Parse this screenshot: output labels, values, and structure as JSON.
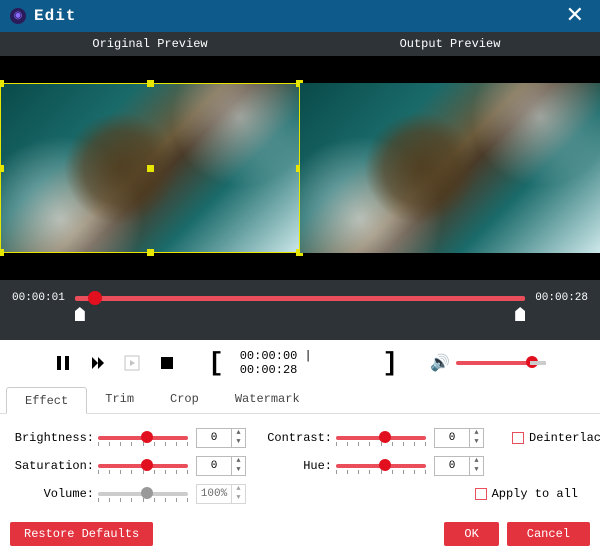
{
  "title": "Edit",
  "close_glyph": "✕",
  "preview": {
    "original_label": "Original Preview",
    "output_label": "Output Preview"
  },
  "timeline": {
    "current": "00:00:01",
    "total": "00:00:28",
    "playhead_pct": 3,
    "mark_in_pct": 0,
    "mark_out_pct": 100
  },
  "range": {
    "in": "00:00:00",
    "out": "00:00:28",
    "sep": " | "
  },
  "volume": {
    "pct": 82
  },
  "tabs": {
    "effect": "Effect",
    "trim": "Trim",
    "crop": "Crop",
    "watermark": "Watermark",
    "active": "effect"
  },
  "effects": {
    "brightness": {
      "label": "Brightness:",
      "value": "0",
      "pos_pct": 50
    },
    "contrast": {
      "label": "Contrast:",
      "value": "0",
      "pos_pct": 50
    },
    "saturation": {
      "label": "Saturation:",
      "value": "0",
      "pos_pct": 50
    },
    "hue": {
      "label": "Hue:",
      "value": "0",
      "pos_pct": 50
    },
    "volume": {
      "label": "Volume:",
      "value": "100%",
      "pos_pct": 50
    }
  },
  "checkboxes": {
    "deinterlacing": "Deinterlacing",
    "apply_all": "Apply to all"
  },
  "buttons": {
    "restore": "Restore Defaults",
    "ok": "OK",
    "cancel": "Cancel"
  },
  "icons": {
    "app": "◉",
    "pause": "pause",
    "next": "next-frame",
    "step": "step",
    "stop": "stop",
    "mark_in": "[",
    "mark_out": "]",
    "speaker": "🔊"
  },
  "colors": {
    "accent": "#e2333f",
    "titlebar": "#0e5a8a",
    "crop": "#e6e600"
  }
}
